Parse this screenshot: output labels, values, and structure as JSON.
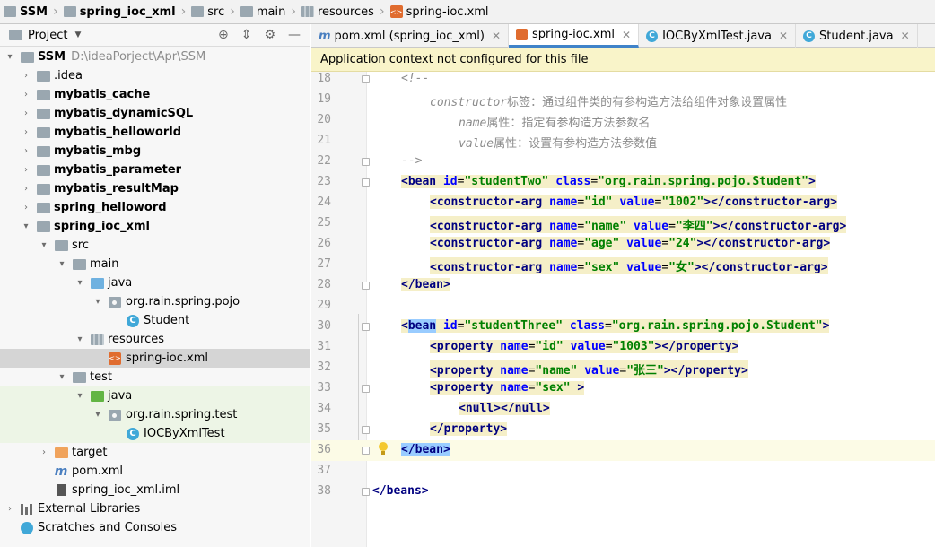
{
  "breadcrumb": [
    {
      "label": "SSM",
      "bold": true,
      "icon": "folder-icon"
    },
    {
      "label": "spring_ioc_xml",
      "bold": true,
      "icon": "folder-icon"
    },
    {
      "label": "src",
      "bold": false,
      "icon": "folder-icon"
    },
    {
      "label": "main",
      "bold": false,
      "icon": "folder-icon"
    },
    {
      "label": "resources",
      "bold": false,
      "icon": "resources-folder-icon"
    },
    {
      "label": "spring-ioc.xml",
      "bold": false,
      "icon": "xml-file-icon"
    }
  ],
  "project_panel": {
    "title": "Project",
    "root_label": "SSM",
    "root_path": "D:\\ideaPorject\\Apr\\SSM",
    "items": [
      {
        "label": ".idea",
        "bold": false
      },
      {
        "label": "mybatis_cache",
        "bold": true
      },
      {
        "label": "mybatis_dynamicSQL",
        "bold": true
      },
      {
        "label": "mybatis_helloworld",
        "bold": true
      },
      {
        "label": "mybatis_mbg",
        "bold": true
      },
      {
        "label": "mybatis_parameter",
        "bold": true
      },
      {
        "label": "mybatis_resultMap",
        "bold": true
      },
      {
        "label": "spring_helloword",
        "bold": true
      },
      {
        "label": "spring_ioc_xml",
        "bold": true
      },
      {
        "label": "src",
        "bold": false
      },
      {
        "label": "main",
        "bold": false
      },
      {
        "label": "java",
        "bold": false
      },
      {
        "label": "org.rain.spring.pojo",
        "bold": false
      },
      {
        "label": "Student",
        "bold": false
      },
      {
        "label": "resources",
        "bold": false
      },
      {
        "label": "spring-ioc.xml",
        "bold": false
      },
      {
        "label": "test",
        "bold": false
      },
      {
        "label": "java",
        "bold": false
      },
      {
        "label": "org.rain.spring.test",
        "bold": false
      },
      {
        "label": "IOCByXmlTest",
        "bold": false
      },
      {
        "label": "target",
        "bold": false
      },
      {
        "label": "pom.xml",
        "bold": false
      },
      {
        "label": "spring_ioc_xml.iml",
        "bold": false
      },
      {
        "label": "External Libraries",
        "bold": false
      },
      {
        "label": "Scratches and Consoles",
        "bold": false
      }
    ]
  },
  "tabs": [
    {
      "label": "pom.xml (spring_ioc_xml)",
      "icon": "maven-icon",
      "active": false
    },
    {
      "label": "spring-ioc.xml",
      "icon": "xml-file-icon",
      "active": true
    },
    {
      "label": "IOCByXmlTest.java",
      "icon": "class-icon",
      "active": false
    },
    {
      "label": "Student.java",
      "icon": "class-icon",
      "active": false
    }
  ],
  "notice": "Application context not configured for this file",
  "editor": {
    "line_numbers": [
      "18",
      "19",
      "20",
      "21",
      "22",
      "23",
      "24",
      "25",
      "26",
      "27",
      "28",
      "29",
      "30",
      "31",
      "32",
      "33",
      "34",
      "35",
      "36",
      "37",
      "38"
    ],
    "lines": {
      "l18": "<!--",
      "l19_a": "constructor",
      "l19_b": "标签：通过组件类的有参构造方法给组件对象设置属性",
      "l20_a": "name",
      "l20_b": "属性：指定有参构造方法参数名",
      "l21_a": "value",
      "l21_b": "属性：设置有参构造方法参数值",
      "l22": "-->",
      "l23": {
        "tag": "bean",
        "a1": "id",
        "v1": "\"studentTwo\"",
        "a2": "class",
        "v2": "\"org.rain.spring.pojo.Student\""
      },
      "l24": {
        "tag": "constructor-arg",
        "a1": "name",
        "v1": "\"id\"",
        "a2": "value",
        "v2": "\"1002\""
      },
      "l25": {
        "tag": "constructor-arg",
        "a1": "name",
        "v1": "\"name\"",
        "a2": "value",
        "v2": "\"李四\""
      },
      "l26": {
        "tag": "constructor-arg",
        "a1": "name",
        "v1": "\"age\"",
        "a2": "value",
        "v2": "\"24\""
      },
      "l27": {
        "tag": "constructor-arg",
        "a1": "name",
        "v1": "\"sex\"",
        "a2": "value",
        "v2": "\"女\""
      },
      "l28": "</bean>",
      "l30": {
        "tag": "bean",
        "a1": "id",
        "v1": "\"studentThree\"",
        "a2": "class",
        "v2": "\"org.rain.spring.pojo.Student\""
      },
      "l31": {
        "tag": "property",
        "a1": "name",
        "v1": "\"id\"",
        "a2": "value",
        "v2": "\"1003\""
      },
      "l32": {
        "tag": "property",
        "a1": "name",
        "v1": "\"name\"",
        "a2": "value",
        "v2": "\"张三\""
      },
      "l33": {
        "tag": "property",
        "a1": "name",
        "v1": "\"sex\""
      },
      "l34": "<null></null>",
      "l35": "</property>",
      "l36": "</bean>",
      "l38": "</beans>"
    }
  },
  "colors": {
    "tag": "#000080",
    "attr": "#0000ff",
    "value": "#008000",
    "comment": "#8c8c8c",
    "accent": "#4083c9",
    "notice_bg": "#f9f4c9"
  }
}
